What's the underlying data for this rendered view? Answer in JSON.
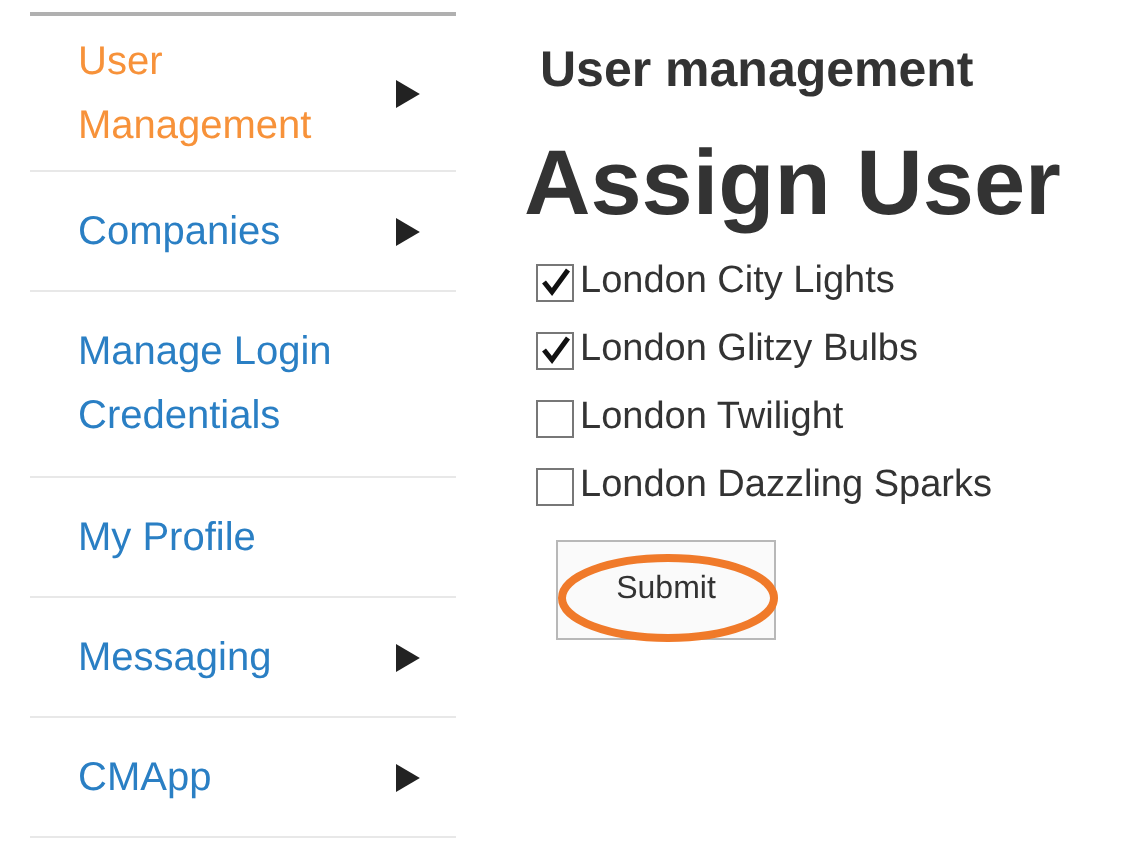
{
  "sidebar": {
    "items": [
      {
        "label": "User Management",
        "selected": true,
        "has_submenu": true
      },
      {
        "label": "Companies",
        "selected": false,
        "has_submenu": true
      },
      {
        "label": "Manage Login Credentials",
        "selected": false,
        "has_submenu": false
      },
      {
        "label": "My Profile",
        "selected": false,
        "has_submenu": false
      },
      {
        "label": "Messaging",
        "selected": false,
        "has_submenu": true
      },
      {
        "label": "CMApp",
        "selected": false,
        "has_submenu": true
      }
    ]
  },
  "main": {
    "section_title": "User management",
    "heading": "Assign User",
    "companies": [
      {
        "label": "London City Lights",
        "checked": true
      },
      {
        "label": "London Glitzy Bulbs",
        "checked": true
      },
      {
        "label": "London Twilight",
        "checked": false
      },
      {
        "label": "London Dazzling Sparks",
        "checked": false
      }
    ],
    "submit": {
      "label": "Submit",
      "highlighted": true
    }
  }
}
